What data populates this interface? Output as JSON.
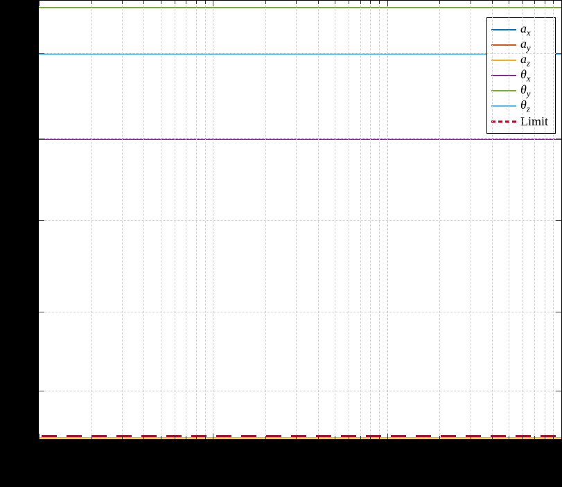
{
  "chart_data": {
    "type": "line",
    "title": "",
    "xlabel": "",
    "ylabel": "",
    "xlim": [
      0,
      100
    ],
    "ylim": [
      0,
      1
    ],
    "x": [
      0,
      100
    ],
    "series": [
      {
        "name": "a_x",
        "color": "#0072BD",
        "values": [
          0.005,
          0.005
        ],
        "style": "solid"
      },
      {
        "name": "a_y",
        "color": "#D95319",
        "values": [
          0.005,
          0.005
        ],
        "style": "solid"
      },
      {
        "name": "a_z",
        "color": "#EDB120",
        "values": [
          0.005,
          0.005
        ],
        "style": "solid"
      },
      {
        "name": "theta_x",
        "color": "#7E2F8E",
        "values": [
          0.685,
          0.685
        ],
        "style": "solid"
      },
      {
        "name": "theta_y",
        "color": "#77AC30",
        "values": [
          0.985,
          0.985
        ],
        "style": "solid"
      },
      {
        "name": "theta_z",
        "color": "#4DBEEE",
        "values": [
          0.88,
          0.88
        ],
        "style": "solid"
      },
      {
        "name": "Limit",
        "color": "#A2142F",
        "values": [
          0.01,
          0.01
        ],
        "style": "dashed"
      }
    ],
    "legend": {
      "position": "northeast",
      "entries": [
        "a_x",
        "a_y",
        "a_z",
        "theta_x",
        "theta_y",
        "theta_z",
        "Limit"
      ]
    },
    "grid": true,
    "y_ticks_major": [
      0.11,
      0.29,
      0.5,
      0.685,
      0.88
    ],
    "x_decades": 3
  },
  "legend_html": {
    "ax": "a<sub>x</sub>",
    "ay": "a<sub>y</sub>",
    "az": "a<sub>z</sub>",
    "tx": "θ<sub>x</sub>",
    "ty": "θ<sub>y</sub>",
    "tz": "θ<sub>z</sub>",
    "limit": "<span class='upright'>Limit</span>"
  }
}
